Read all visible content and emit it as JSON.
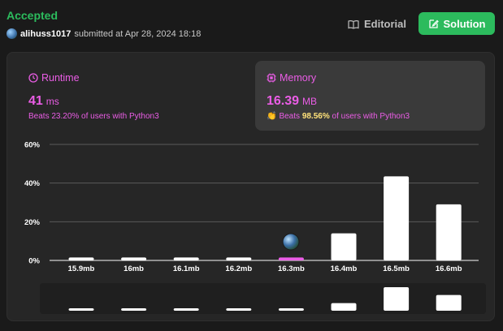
{
  "header": {
    "status": "Accepted",
    "username": "alihuss1017",
    "submitted_text": "submitted at Apr 28, 2024 18:18",
    "editorial_label": "Editorial",
    "solution_label": "Solution"
  },
  "runtime": {
    "title": "Runtime",
    "value": "41",
    "unit": "ms",
    "beats_text": "Beats 23.20% of users with Python3"
  },
  "memory": {
    "title": "Memory",
    "value": "16.39",
    "unit": "MB",
    "beats_prefix": "Beats",
    "beats_pct": "98.56%",
    "beats_suffix": "of users with Python3"
  },
  "chart_data": {
    "type": "bar",
    "categories": [
      "15.9mb",
      "16mb",
      "16.1mb",
      "16.2mb",
      "16.3mb",
      "16.4mb",
      "16.5mb",
      "16.6mb"
    ],
    "values": [
      1.5,
      1.5,
      1.5,
      1.5,
      1.5,
      14,
      43.5,
      29
    ],
    "highlight_index": 4,
    "y_ticks": [
      "0%",
      "20%",
      "40%",
      "60%"
    ],
    "ylim": [
      0,
      60
    ],
    "colors": {
      "bar": "#ffffff",
      "highlight": "#eb5de6",
      "grid": "#5a5a5a",
      "text": "#ffffff"
    }
  }
}
